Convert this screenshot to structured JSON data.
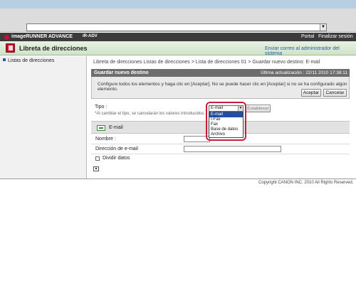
{
  "browser": {
    "address_value": ""
  },
  "header": {
    "product_name": "imageRUNNER ADVANCE",
    "device_name": "iR-ADV",
    "portal_label": "Portal",
    "logout_label": "Finalizar sesión"
  },
  "titlebar": {
    "title": "Libreta de direcciones",
    "mail_admin_label": "Enviar correo al administrador del sistema"
  },
  "sidebar": {
    "items": [
      {
        "label": "Listas de direcciones"
      }
    ]
  },
  "main": {
    "breadcrumb": "Libreta de direcciones  Listas de direcciones > Lista de direcciones 01 > Guardar nuevo destino: E-mail",
    "panel_title": "Guardar nuevo destino",
    "last_updated": "Última actualización : 22/11 2010 17:38:11",
    "info_text": "Configure todos los elementos y haga clic en [Aceptar]. No se puede hacer clic en [Aceptar] si no se ha configurado algún elemento.",
    "accept_label": "Aceptar",
    "cancel_label": "Cancelar",
    "tipo_label": "Tipo :",
    "tipo_note": "*Al cambiar el tipo, se cancelarán los valores introducidos.",
    "tipo_selected": "E-mail",
    "tipo_options": [
      "E-mail",
      "I-Fax",
      "Fax",
      "Base de datos",
      "Archivo"
    ],
    "set_label": "Establecer",
    "section_title": "E-mail",
    "name_label": "Nombre :",
    "name_value": "",
    "email_label": "Dirección de e-mail",
    "email_value": "",
    "split_label": "Dividir datos"
  },
  "footer": {
    "copyright": "Copyright CANON INC. 2010 All Rights Reserved."
  }
}
